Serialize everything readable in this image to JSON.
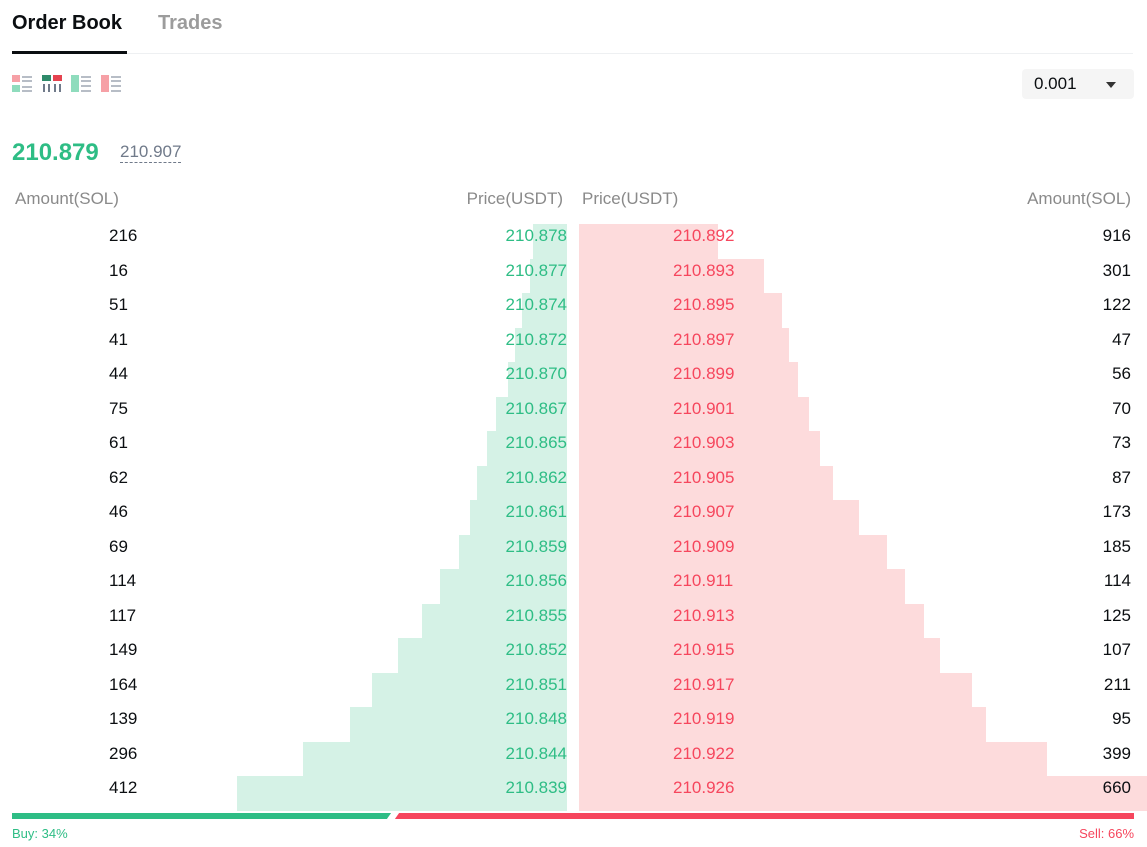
{
  "tabs": [
    {
      "label": "Order Book",
      "active": true
    },
    {
      "label": "Trades",
      "active": false
    }
  ],
  "view_modes": [
    "both-sides-icon",
    "depth-columns-icon",
    "bids-only-icon",
    "asks-only-icon"
  ],
  "precision": {
    "value": "0.001"
  },
  "last_price": "210.879",
  "mark_price": "210.907",
  "headers": {
    "bid_amount": "Amount(SOL)",
    "bid_price": "Price(USDT)",
    "ask_price": "Price(USDT)",
    "ask_amount": "Amount(SOL)"
  },
  "rows": [
    {
      "bid_amount": "216",
      "bid_price": "210.878",
      "ask_price": "210.892",
      "ask_amount": "916",
      "bid_depth": 216,
      "ask_depth": 916
    },
    {
      "bid_amount": "16",
      "bid_price": "210.877",
      "ask_price": "210.893",
      "ask_amount": "301",
      "bid_depth": 232,
      "ask_depth": 1217
    },
    {
      "bid_amount": "51",
      "bid_price": "210.874",
      "ask_price": "210.895",
      "ask_amount": "122",
      "bid_depth": 283,
      "ask_depth": 1339
    },
    {
      "bid_amount": "41",
      "bid_price": "210.872",
      "ask_price": "210.897",
      "ask_amount": "47",
      "bid_depth": 324,
      "ask_depth": 1386
    },
    {
      "bid_amount": "44",
      "bid_price": "210.870",
      "ask_price": "210.899",
      "ask_amount": "56",
      "bid_depth": 368,
      "ask_depth": 1442
    },
    {
      "bid_amount": "75",
      "bid_price": "210.867",
      "ask_price": "210.901",
      "ask_amount": "70",
      "bid_depth": 443,
      "ask_depth": 1512
    },
    {
      "bid_amount": "61",
      "bid_price": "210.865",
      "ask_price": "210.903",
      "ask_amount": "73",
      "bid_depth": 504,
      "ask_depth": 1585
    },
    {
      "bid_amount": "62",
      "bid_price": "210.862",
      "ask_price": "210.905",
      "ask_amount": "87",
      "bid_depth": 566,
      "ask_depth": 1672
    },
    {
      "bid_amount": "46",
      "bid_price": "210.861",
      "ask_price": "210.907",
      "ask_amount": "173",
      "bid_depth": 612,
      "ask_depth": 1845
    },
    {
      "bid_amount": "69",
      "bid_price": "210.859",
      "ask_price": "210.909",
      "ask_amount": "185",
      "bid_depth": 681,
      "ask_depth": 2030
    },
    {
      "bid_amount": "114",
      "bid_price": "210.856",
      "ask_price": "210.911",
      "ask_amount": "114",
      "bid_depth": 795,
      "ask_depth": 2144
    },
    {
      "bid_amount": "117",
      "bid_price": "210.855",
      "ask_price": "210.913",
      "ask_amount": "125",
      "bid_depth": 912,
      "ask_depth": 2269
    },
    {
      "bid_amount": "149",
      "bid_price": "210.852",
      "ask_price": "210.915",
      "ask_amount": "107",
      "bid_depth": 1061,
      "ask_depth": 2376
    },
    {
      "bid_amount": "164",
      "bid_price": "210.851",
      "ask_price": "210.917",
      "ask_amount": "211",
      "bid_depth": 1225,
      "ask_depth": 2587
    },
    {
      "bid_amount": "139",
      "bid_price": "210.848",
      "ask_price": "210.919",
      "ask_amount": "95",
      "bid_depth": 1364,
      "ask_depth": 2682
    },
    {
      "bid_amount": "296",
      "bid_price": "210.844",
      "ask_price": "210.922",
      "ask_amount": "399",
      "bid_depth": 1660,
      "ask_depth": 3081
    },
    {
      "bid_amount": "412",
      "bid_price": "210.839",
      "ask_price": "210.926",
      "ask_amount": "660",
      "bid_depth": 2072,
      "ask_depth": 3741
    }
  ],
  "ratio": {
    "buy_label": "Buy: 34%",
    "sell_label": "Sell: 66%",
    "buy_fraction": 0.34,
    "sell_fraction": 0.66
  },
  "colors": {
    "buy": "#2ebd85",
    "sell": "#f6465d",
    "buy_bg": "#d5f2e6",
    "sell_bg": "#fddbdc"
  }
}
